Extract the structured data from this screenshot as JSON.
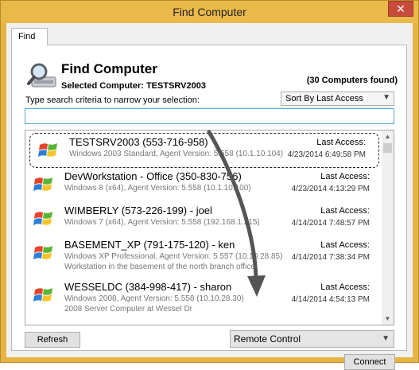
{
  "window": {
    "title": "Find Computer",
    "close_glyph": "✕"
  },
  "tab": {
    "label": "Find"
  },
  "header": {
    "title": "Find Computer",
    "selected_computer": "Selected Computer: TESTSRV2003",
    "count": "(30 Computers found)",
    "hint": "Type search criteria to narrow your selection:",
    "icon": "search-computer-icon"
  },
  "sort": {
    "value": "Sort By Last Access"
  },
  "search": {
    "value": ""
  },
  "computers": [
    {
      "name": "TESTSRV2003 (553-716-958)",
      "detail": "Windows 2003 Standard, Agent Version: 5.558 (10.1.10.104)",
      "desc": "",
      "last_label": "Last Access:",
      "last_date": "4/23/2014 6:49:58 PM",
      "selected": true,
      "icon": "windows-logo-icon"
    },
    {
      "name": "DevWorkstation - Office (350-830-756)",
      "detail": "Windows 8 (x64), Agent Version: 5.558 (10.1.10.100)",
      "desc": "",
      "last_label": "Last Access:",
      "last_date": "4/23/2014 4:13:29 PM",
      "selected": false,
      "icon": "windows-logo-icon"
    },
    {
      "name": "WIMBERLY (573-226-199) - joel",
      "detail": "Windows 7 (x64), Agent Version: 5.558 (192.168.1.215)",
      "desc": "",
      "last_label": "Last Access:",
      "last_date": "4/14/2014 7:48:57 PM",
      "selected": false,
      "icon": "windows-logo-icon"
    },
    {
      "name": "BASEMENT_XP (791-175-120) - ken",
      "detail": "Windows XP Professional, Agent Version: 5.557 (10.10.28.85)",
      "desc": "Workstation in the basement of the north branch office.",
      "last_label": "Last Access:",
      "last_date": "4/14/2014 7:38:34 PM",
      "selected": false,
      "icon": "windows-logo-icon"
    },
    {
      "name": "WESSELDC (384-998-417) - sharon",
      "detail": "Windows 2008, Agent Version: 5.558 (10.10.28.30)",
      "desc": "2008 Server Computer at Wessel Dr",
      "last_label": "Last Access:",
      "last_date": "4/14/2014 4:54:13 PM",
      "selected": false,
      "icon": "windows-logo-icon"
    }
  ],
  "buttons": {
    "refresh": "Refresh",
    "connect": "Connect"
  },
  "action": {
    "value": "Remote Control"
  },
  "colors": {
    "title_bar": "#e9b94a",
    "close": "#c74b3a",
    "focus_border": "#5aa5dd"
  }
}
